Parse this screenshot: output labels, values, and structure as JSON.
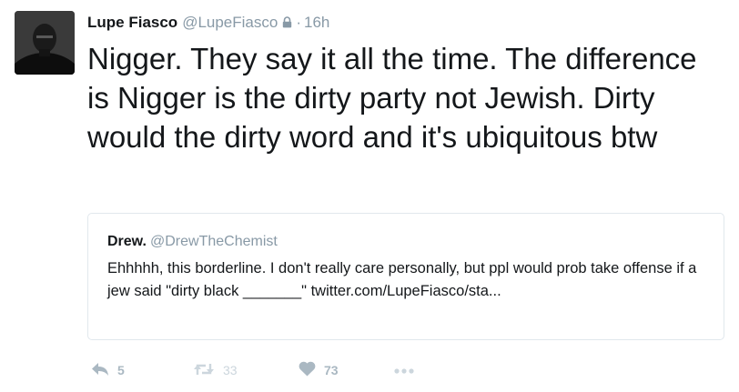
{
  "tweet": {
    "author_name": "Lupe Fiasco",
    "author_handle": "@LupeFiasco",
    "separator": "·",
    "timestamp": "16h",
    "text": "Nigger. They say it all the time. The difference is Nigger is the dirty party not Jewish. Dirty would the dirty word and it's ubiquitous btw"
  },
  "quoted_tweet": {
    "author_name": "Drew.",
    "author_handle": "@DrewTheChemist",
    "text": "Ehhhhh, this borderline. I don't really care personally, but ppl would prob take offense if a jew said \"dirty black _______\" twitter.com/LupeFiasco/sta..."
  },
  "actions": {
    "reply_count": "5",
    "retweet_count": "33",
    "like_count": "73"
  },
  "icons": {
    "reply": "reply-icon",
    "retweet": "retweet-icon",
    "like": "heart-icon",
    "more": "more-icon",
    "protected": "lock-icon"
  },
  "colors": {
    "text": "#14171a",
    "muted": "#8899a6",
    "action_gray": "#aab8c2",
    "border": "#e1e8ed"
  }
}
